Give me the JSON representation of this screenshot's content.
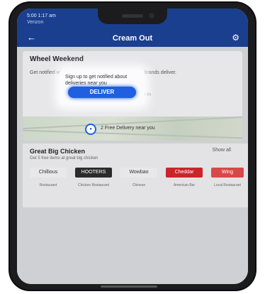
{
  "status": {
    "time": "5:00 1:17 am",
    "carrier": "Verizon"
  },
  "appbar": {
    "back_icon": "back-arrow-icon",
    "title": "Cream Out",
    "action_icon": "bell-icon"
  },
  "card": {
    "title": "Wheel Weekend",
    "description": "Get notified when your favorite restaurant and store brands deliver.",
    "link_text": "Opt-in",
    "tooltip_text": "Sign up to get notified about deliveries near you",
    "button_label": "DELIVER"
  },
  "map": {
    "label": "2 Free Delivery near you"
  },
  "section": {
    "title": "Great Big Chicken",
    "subtitle": "Get 5 free items at great big chicken",
    "link": "Show all",
    "brands": [
      {
        "name": "Chillious",
        "caption": "Restaurant",
        "bg": "#e8e8ea",
        "fg": "#333333"
      },
      {
        "name": "HOOTERS",
        "caption": "Chicken Restaurant",
        "bg": "#2b2b2b",
        "fg": "#ffffff"
      },
      {
        "name": "Wowbao",
        "caption": "Chinese",
        "bg": "#e8e8ea",
        "fg": "#333333"
      },
      {
        "name": "Cheddar",
        "caption": "American Bar",
        "bg": "#c9262c",
        "fg": "#ffffff"
      },
      {
        "name": "Wing",
        "caption": "Local Restaurant",
        "bg": "#d94848",
        "fg": "#ffffff"
      }
    ]
  },
  "colors": {
    "brand_blue": "#1b3f8f",
    "button_blue": "#1f5fe0"
  }
}
